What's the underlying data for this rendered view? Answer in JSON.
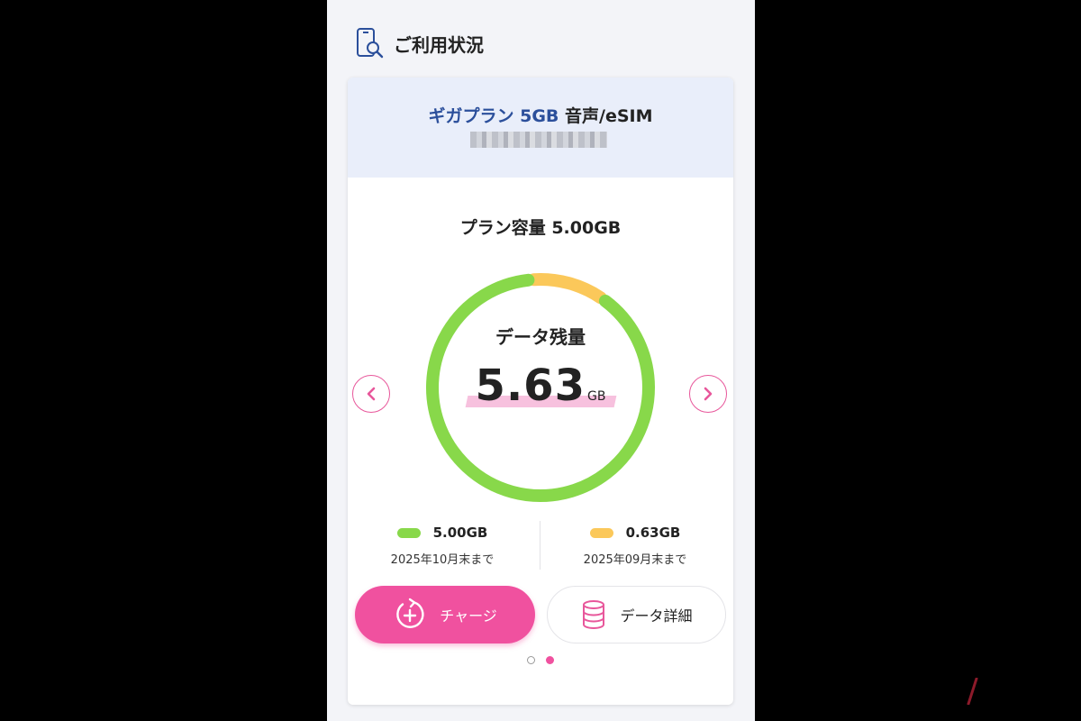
{
  "section": {
    "title": "ご利用状況",
    "icon": "phone-search-icon"
  },
  "plan": {
    "name_blue": "ギガプラン 5GB",
    "name_rest": " 音声/eSIM"
  },
  "capacity_label": "プラン容量 5.00GB",
  "ring": {
    "label": "データ残量",
    "value": "5.63",
    "unit": "GB",
    "segments": [
      {
        "amount_gb": 5.0,
        "color": "#88d84a"
      },
      {
        "amount_gb": 0.63,
        "color": "#fbc85a"
      }
    ]
  },
  "legend": [
    {
      "amount": "5.00GB",
      "date": "2025年10月末まで",
      "color": "#88d84a"
    },
    {
      "amount": "0.63GB",
      "date": "2025年09月末まで",
      "color": "#fbc85a"
    }
  ],
  "buttons": {
    "charge": {
      "label": "チャージ",
      "icon": "charge-plus-icon"
    },
    "detail": {
      "label": "データ詳細",
      "icon": "database-icon"
    }
  },
  "nav": {
    "prev_icon": "chevron-left-icon",
    "next_icon": "chevron-right-icon"
  },
  "pagination": {
    "total": 2,
    "active": 2
  },
  "colors": {
    "accent": "#f0519f",
    "plan_blue": "#2b4f9b",
    "header_bg": "#e9eefa"
  }
}
